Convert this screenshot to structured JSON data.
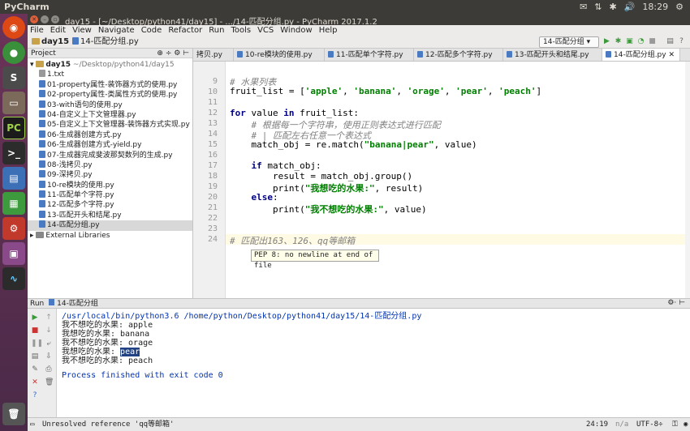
{
  "system": {
    "app_name": "PyCharm",
    "time": "18:29",
    "tray": [
      "✉",
      "⇅",
      "✱",
      "🔊"
    ]
  },
  "window": {
    "title": "day15 - [~/Desktop/python41/day15] - .../14-匹配分组.py - PyCharm 2017.1.2"
  },
  "menu": [
    "File",
    "Edit",
    "View",
    "Navigate",
    "Code",
    "Refactor",
    "Run",
    "Tools",
    "VCS",
    "Window",
    "Help"
  ],
  "navbar": {
    "crumbs": [
      "day15",
      "14-匹配分组.py"
    ],
    "run_config": "14-匹配分组"
  },
  "project": {
    "header": "Project",
    "root_name": "day15",
    "root_path": "~/Desktop/python41/day15",
    "files": [
      "1.txt",
      "01-property属性-装饰器方式的使用.py",
      "02-property属性-类属性方式的使用.py",
      "03-with语句的使用.py",
      "04-自定义上下文管理器.py",
      "05-自定义上下文管理器-装饰器方式实现.py",
      "06-生成器创建方式.py",
      "06-生成器创建方式-yield.py",
      "07-生成器完成斐波那契数列的生成.py",
      "08-浅拷贝.py",
      "09-深拷贝.py",
      "10-re模块的使用.py",
      "11-匹配单个字符.py",
      "12-匹配多个字符.py",
      "13-匹配开头和结尾.py",
      "14-匹配分组.py"
    ],
    "external": "External Libraries"
  },
  "tabs": [
    "拷贝.py",
    "10-re模块的使用.py",
    "11-匹配单个字符.py",
    "12-匹配多个字符.py",
    "13-匹配开头和结尾.py",
    "14-匹配分组.py"
  ],
  "editor": {
    "line_numbers": [
      "9",
      "10",
      "11",
      "12",
      "13",
      "14",
      "15",
      "16",
      "17",
      "18",
      "19",
      "20",
      "21",
      "22",
      "23",
      "24"
    ],
    "tooltip": "PEP 8: no newline at end of file"
  },
  "run": {
    "tab_label": "Run",
    "config": "14-匹配分组",
    "command": "/usr/local/bin/python3.6 /home/python/Desktop/python41/day15/14-匹配分组.py",
    "output": [
      "我不想吃的水果: apple",
      "我想吃的水果: banana",
      "我不想吃的水果: orage",
      "我想吃的水果: ",
      "我不想吃的水果: peach"
    ],
    "highlight": "pear",
    "exit": "Process finished with exit code 0"
  },
  "status": {
    "message": "Unresolved reference 'qq等邮箱'",
    "position": "24:19",
    "line_sep": "n/a",
    "encoding": "UTF-8÷"
  }
}
